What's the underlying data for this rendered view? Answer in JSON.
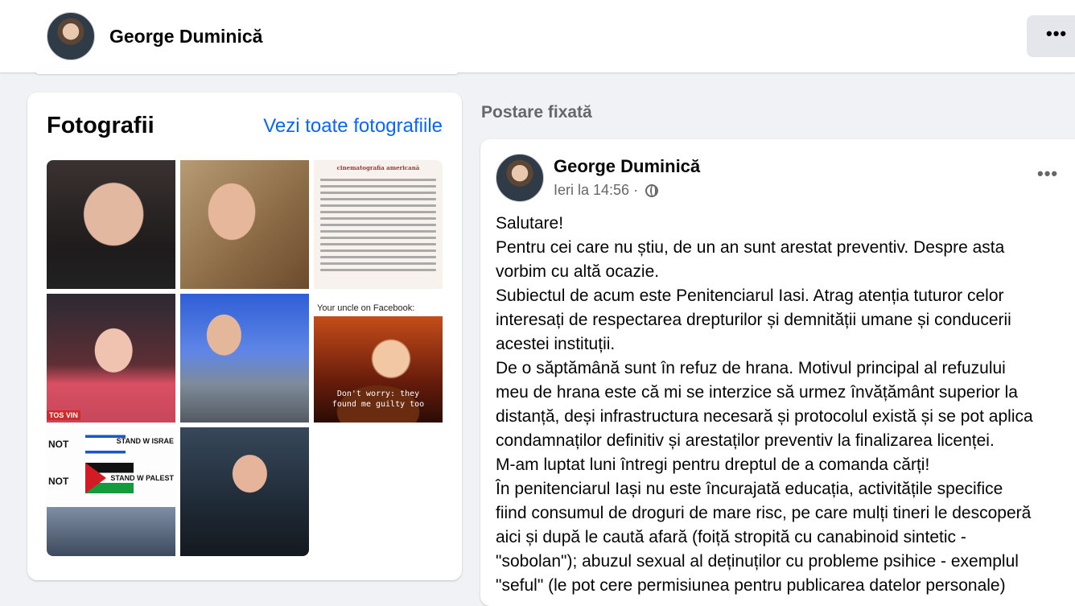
{
  "header": {
    "name": "George Duminică",
    "more_label": "•••"
  },
  "photos": {
    "title": "Fotografii",
    "see_all": "Vezi toate fotografiile",
    "doc_heading": "cinematografia americană",
    "uncle_caption": "Your uncle on Facebook:",
    "uncle_text_1": "Don't worry: they",
    "uncle_text_2": "found me guilty too",
    "badge": "TOS VIN",
    "not_1": "NOT",
    "not_2": "NOT",
    "stand_1": "STAND W ISRAE",
    "stand_2": "STAND W PALEST"
  },
  "pinned": {
    "label": "Postare fixată"
  },
  "post": {
    "author": "George Duminică",
    "time": "Ieri la 14:56",
    "separator": "·",
    "globe_icon": "globe-icon",
    "more_label": "•••",
    "lines": [
      "Salutare!",
      "Pentru cei care nu știu, de un an sunt arestat preventiv. Despre asta",
      "vorbim cu altă ocazie.",
      "Subiectul de acum este Penitenciarul Iasi. Atrag atenția tuturor celor",
      "interesați de respectarea drepturilor și demnității umane și conducerii",
      "acestei instituții.",
      "De o săptămână sunt în refuz de hrana. Motivul principal al refuzului",
      "meu de hrana este că mi se interzice să urmez învățământ superior la",
      "distanță, deși infrastructura necesară și protocolul există și se pot aplica",
      "condamnaților definitiv și arestaților preventiv la finalizarea licenței.",
      "M-am luptat luni întregi pentru dreptul de a comanda cărți!",
      "În penitenciarul Iași nu este încurajată educația,  activitățile specifice",
      "fiind consumul de droguri de mare risc, pe care mulți tineri le descoperă",
      "aici și după le caută afară (foiță stropită cu canabinoid sintetic -",
      "\"sobolan\"); abuzul sexual al deținuților cu probleme psihice - exemplul",
      "\"seful\" (le pot cere permisiunea pentru publicarea datelor personale)"
    ]
  }
}
